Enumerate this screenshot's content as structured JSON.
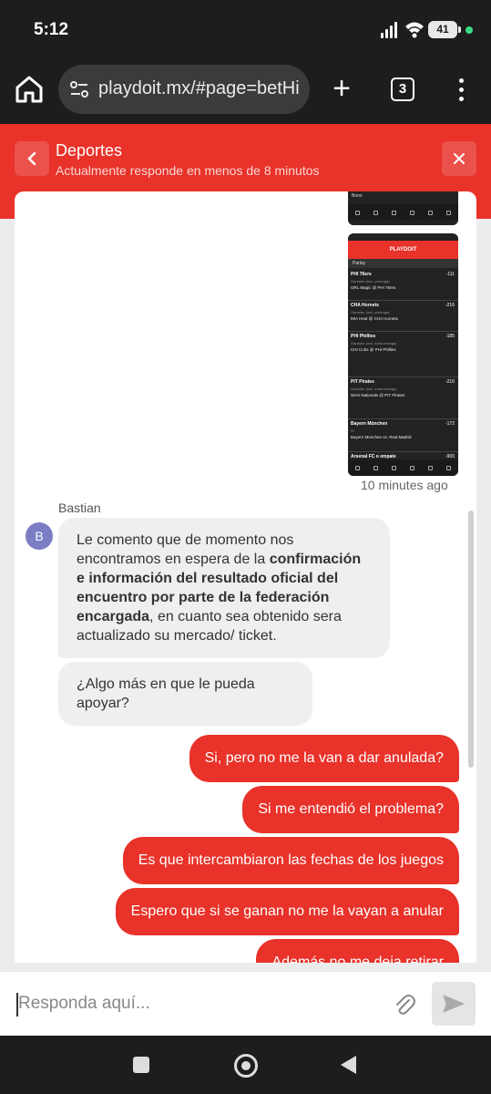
{
  "status_bar": {
    "time": "5:12",
    "battery": "41"
  },
  "browser": {
    "url": "playdoit.mx/#page=betHi",
    "tab_count": "3"
  },
  "header": {
    "title": "Deportes",
    "subtitle": "Actualmente responde en menos de 8 minutos"
  },
  "attachments": {
    "top_label": "Bono",
    "brand": "PLAYDOIT",
    "section": "Parlay",
    "rows": [
      {
        "team": "PHI 76ers",
        "odd": "-111",
        "market": "Ganador (incl. prórroga)",
        "match": "ORL Magic @ PHI 76ers"
      },
      {
        "team": "CHA Hornets",
        "odd": "-216",
        "market": "Ganador (incl. prórroga)",
        "match": "MIA Heat @ CHA Hornets"
      },
      {
        "team": "PHI Phillies",
        "odd": "-185",
        "market": "Ganador (incl. extra innings)",
        "match": "CHI Cubs @ PHI Phillies"
      },
      {
        "team": "PIT Pirates",
        "odd": "-210",
        "market": "Ganador (incl. extra innings)",
        "match": "WAS Nationals @ PIT Pirates"
      },
      {
        "team": "Bayern München",
        "odd": "-172",
        "market": "Sí",
        "match": "Bayern München vs. Real Madrid"
      },
      {
        "team": "Arsenal FC o empate",
        "odd": "-900",
        "market": "",
        "match": ""
      }
    ]
  },
  "messages": {
    "time_ago": "10 minutes ago",
    "agent_name": "Bastian",
    "agent_initial": "B",
    "agent_msg_1": {
      "part1": "Le comento que de momento nos encontramos en espera de la ",
      "bold": "confirmación e información del resultado oficial del encuentro por parte de la federación encargada",
      "part2": ", en cuanto sea obtenido sera actualizado su mercado/ ticket."
    },
    "agent_msg_2": "¿Algo más en que le pueda apoyar?",
    "user_msgs": [
      "Si, pero no me la van a dar anulada?",
      "Si me entendió el problema?",
      "Es que intercambiaron las fechas de los juegos",
      "Espero que si se ganan no me la vayan a anular",
      "Además no me deja retirar"
    ]
  },
  "composer": {
    "placeholder": "Responda aquí..."
  },
  "colors": {
    "brand_red": "#e8322a",
    "avatar": "#7a7ec5"
  }
}
